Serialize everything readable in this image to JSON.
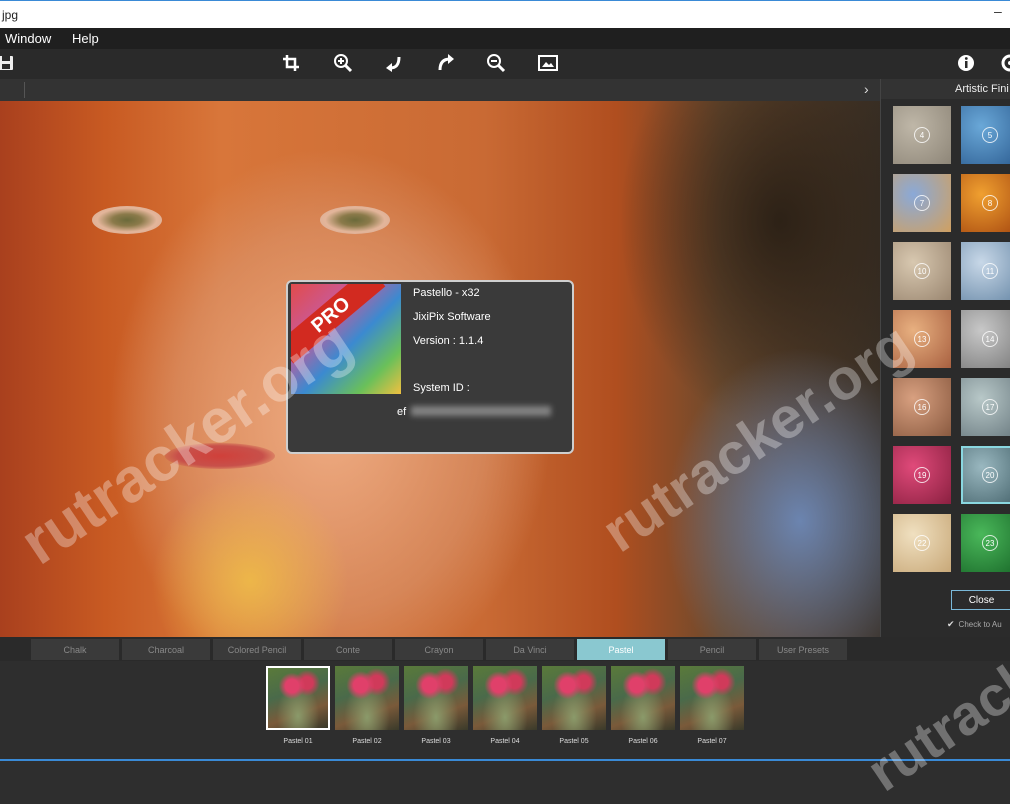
{
  "window": {
    "title": "jpg",
    "minimize_glyph": "–"
  },
  "menu": {
    "items": [
      {
        "label": "Window"
      },
      {
        "label": "Help"
      }
    ]
  },
  "toolbar": {
    "icons": [
      "save-icon",
      "crop-icon",
      "zoom-in-icon",
      "rotate-left-icon",
      "rotate-right-icon",
      "zoom-out-icon",
      "fit-image-icon",
      "info-icon",
      "settings-icon"
    ]
  },
  "subbar": {
    "chevron": "›"
  },
  "watermark": {
    "text": "rutracker.org"
  },
  "about_dialog": {
    "logo_text": "PRO",
    "product": "Pastello - x32",
    "company": "JixiPix Software",
    "version": "Version : 1.1.4",
    "system_id_label": "System ID :",
    "system_id_prefix": "ef"
  },
  "right_panel": {
    "title": "Artistic Fini",
    "thumbnails": [
      {
        "num": "4",
        "color1": "#bfb7a8",
        "color2": "#8e8678"
      },
      {
        "num": "5",
        "color1": "#6aa8d8",
        "color2": "#2e5f93"
      },
      {
        "num": "7",
        "color1": "#8aa9d8",
        "color2": "#d0a060"
      },
      {
        "num": "8",
        "color1": "#f0a030",
        "color2": "#a84a10"
      },
      {
        "num": "10",
        "color1": "#d8c8b0",
        "color2": "#9a8670"
      },
      {
        "num": "11",
        "color1": "#c8d8e8",
        "color2": "#6a8aa8"
      },
      {
        "num": "13",
        "color1": "#e8b080",
        "color2": "#a86040"
      },
      {
        "num": "14",
        "color1": "#c8c8c8",
        "color2": "#7a7a7a"
      },
      {
        "num": "16",
        "color1": "#d8a080",
        "color2": "#8a5a40"
      },
      {
        "num": "17",
        "color1": "#b8c8c8",
        "color2": "#6a7a80"
      },
      {
        "num": "19",
        "color1": "#e04a7a",
        "color2": "#8a2040"
      },
      {
        "num": "20",
        "color1": "#9ab8c0",
        "color2": "#4a6870",
        "selected": true
      },
      {
        "num": "22",
        "color1": "#f0e0c0",
        "color2": "#c8a878"
      },
      {
        "num": "23",
        "color1": "#4ab85a",
        "color2": "#1a6a2a"
      }
    ],
    "close_label": "Close",
    "check_label": "Check to Au",
    "check_mark": "✔"
  },
  "tabs": [
    {
      "label": "Chalk"
    },
    {
      "label": "Charcoal"
    },
    {
      "label": "Colored Pencil"
    },
    {
      "label": "Conte"
    },
    {
      "label": "Crayon"
    },
    {
      "label": "Da Vinci"
    },
    {
      "label": "Pastel",
      "active": true
    },
    {
      "label": "Pencil"
    },
    {
      "label": "User Presets"
    }
  ],
  "presets": [
    {
      "label": "Pastel 01",
      "selected": true
    },
    {
      "label": "Pastel 02"
    },
    {
      "label": "Pastel 03"
    },
    {
      "label": "Pastel 04"
    },
    {
      "label": "Pastel 05"
    },
    {
      "label": "Pastel 06"
    },
    {
      "label": "Pastel 07"
    }
  ]
}
